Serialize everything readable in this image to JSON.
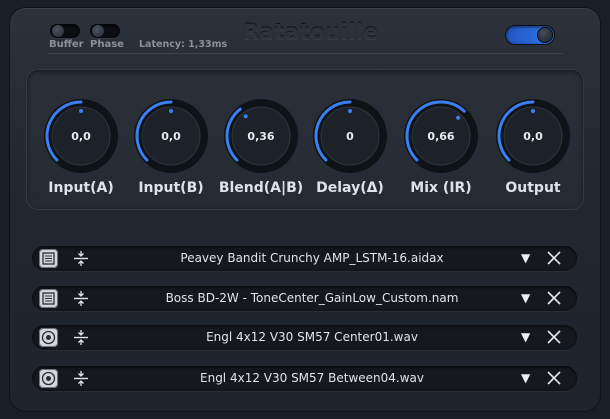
{
  "header": {
    "buffer_label": "Buffer",
    "phase_label": "Phase",
    "latency_text": "Latency: 1,33ms",
    "title": "Ratatouille",
    "buffer_on": false,
    "phase_on": false,
    "power_on": true
  },
  "colors": {
    "accent": "#3b7ff0",
    "background": "#1a1e26",
    "knob_track": "#111418"
  },
  "knobs": [
    {
      "label": "Input(A)",
      "value_text": "0,0",
      "fraction": 0.5
    },
    {
      "label": "Input(B)",
      "value_text": "0,0",
      "fraction": 0.5
    },
    {
      "label": "Blend(A|B)",
      "value_text": "0,36",
      "fraction": 0.36
    },
    {
      "label": "Delay(Δ)",
      "value_text": "0",
      "fraction": 0.5
    },
    {
      "label": "Mix (IR)",
      "value_text": "0,66",
      "fraction": 0.66
    },
    {
      "label": "Output",
      "value_text": "0,0",
      "fraction": 0.5
    }
  ],
  "loaders": [
    {
      "type_icon": "amp-model-icon",
      "file": "Peavey Bandit Crunchy AMP_LSTM-16.aidax"
    },
    {
      "type_icon": "amp-model-icon",
      "file": "Boss BD-2W - ToneCenter_GainLow_Custom.nam"
    },
    {
      "type_icon": "speaker-ir-icon",
      "file": "Engl 4x12 V30 SM57 Center01.wav"
    },
    {
      "type_icon": "speaker-ir-icon",
      "file": "Engl 4x12 V30 SM57 Between04.wav"
    }
  ],
  "dropdown_glyph": "▼"
}
